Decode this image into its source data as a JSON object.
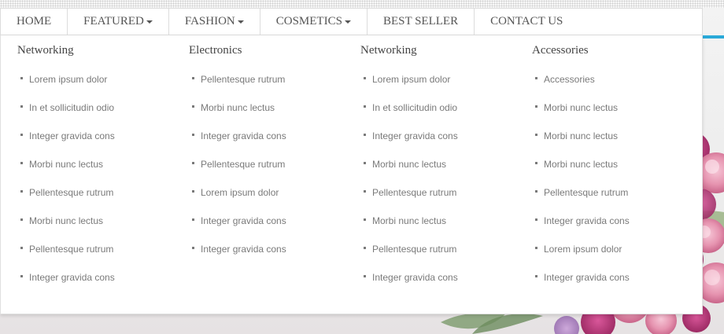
{
  "nav": {
    "items": [
      {
        "label": "HOME",
        "dropdown": false
      },
      {
        "label": "FEATURED",
        "dropdown": true
      },
      {
        "label": "FASHION",
        "dropdown": true
      },
      {
        "label": "COSMETICS",
        "dropdown": true
      },
      {
        "label": "BEST SELLER",
        "dropdown": false
      },
      {
        "label": "CONTACT US",
        "dropdown": false
      }
    ]
  },
  "mega_menu": {
    "columns": [
      {
        "title": "Networking",
        "links": [
          "Lorem ipsum dolor",
          "In et sollicitudin odio",
          "Integer gravida cons",
          "Morbi nunc lectus",
          "Pellentesque rutrum",
          "Morbi nunc lectus",
          "Pellentesque rutrum",
          "Integer gravida cons"
        ]
      },
      {
        "title": "Electronics",
        "links": [
          "Pellentesque rutrum",
          "Morbi nunc lectus",
          "Integer gravida cons",
          "Pellentesque rutrum",
          "Lorem ipsum dolor",
          "Integer gravida cons",
          "Integer gravida cons"
        ]
      },
      {
        "title": "Networking",
        "links": [
          "Lorem ipsum dolor",
          "In et sollicitudin odio",
          "Integer gravida cons",
          "Morbi nunc lectus",
          "Pellentesque rutrum",
          "Morbi nunc lectus",
          "Pellentesque rutrum",
          "Integer gravida cons"
        ]
      },
      {
        "title": "Accessories",
        "links": [
          "Accessories",
          "Morbi nunc lectus",
          "Morbi nunc lectus",
          "Morbi nunc lectus",
          "Pellentesque rutrum",
          "Integer gravida cons",
          "Lorem ipsum dolor",
          "Integer gravida cons"
        ]
      }
    ]
  },
  "colors": {
    "accent": "#29a9d8",
    "nav_text": "#555555",
    "link_text": "#7a7a7a",
    "border": "#dcdcdc"
  },
  "icons": {
    "dropdown_caret": "caret-down-icon",
    "link_bullet": "square-bullet-icon",
    "decoration": "flower-bouquet"
  }
}
